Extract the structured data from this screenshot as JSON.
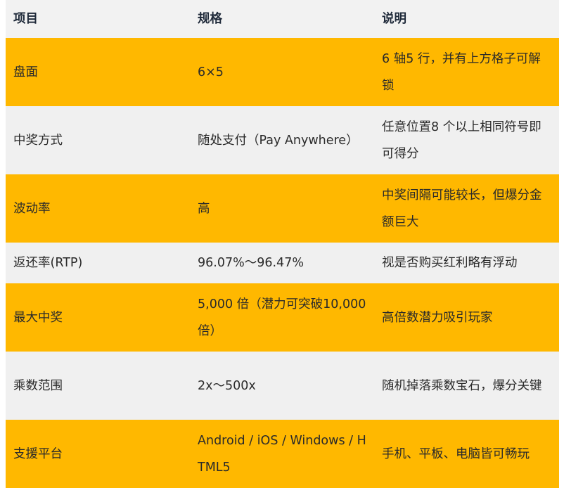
{
  "table": {
    "headers": [
      "项目",
      "规格",
      "说明"
    ],
    "rows": [
      {
        "item": "盘面",
        "spec": "6×5",
        "desc": "6 轴5 行，并有上方格子可解锁"
      },
      {
        "item": "中奖方式",
        "spec": "随处支付（Pay Anywhere）",
        "desc": "任意位置8 个以上相同符号即可得分"
      },
      {
        "item": "波动率",
        "spec": "高",
        "desc": "中奖间隔可能较长，但爆分金额巨大"
      },
      {
        "item": "返还率(RTP)",
        "spec": "96.07%～96.47%",
        "desc": "视是否购买红利略有浮动"
      },
      {
        "item": "最大中奖",
        "spec": "5,000 倍（潜力可突破10,000 倍）",
        "desc": "高倍数潜力吸引玩家"
      },
      {
        "item": "乘数范围",
        "spec": "2x～500x",
        "desc": "随机掉落乘数宝石，爆分关键"
      },
      {
        "item": "支援平台",
        "spec": "Android / iOS / Windows / HTML5",
        "desc": "手机、平板、电脑皆可畅玩"
      }
    ]
  },
  "colors": {
    "highlight_row": "#ffb800",
    "plain_row": "#f0f0f0",
    "header_row": "#f2f2f2"
  }
}
